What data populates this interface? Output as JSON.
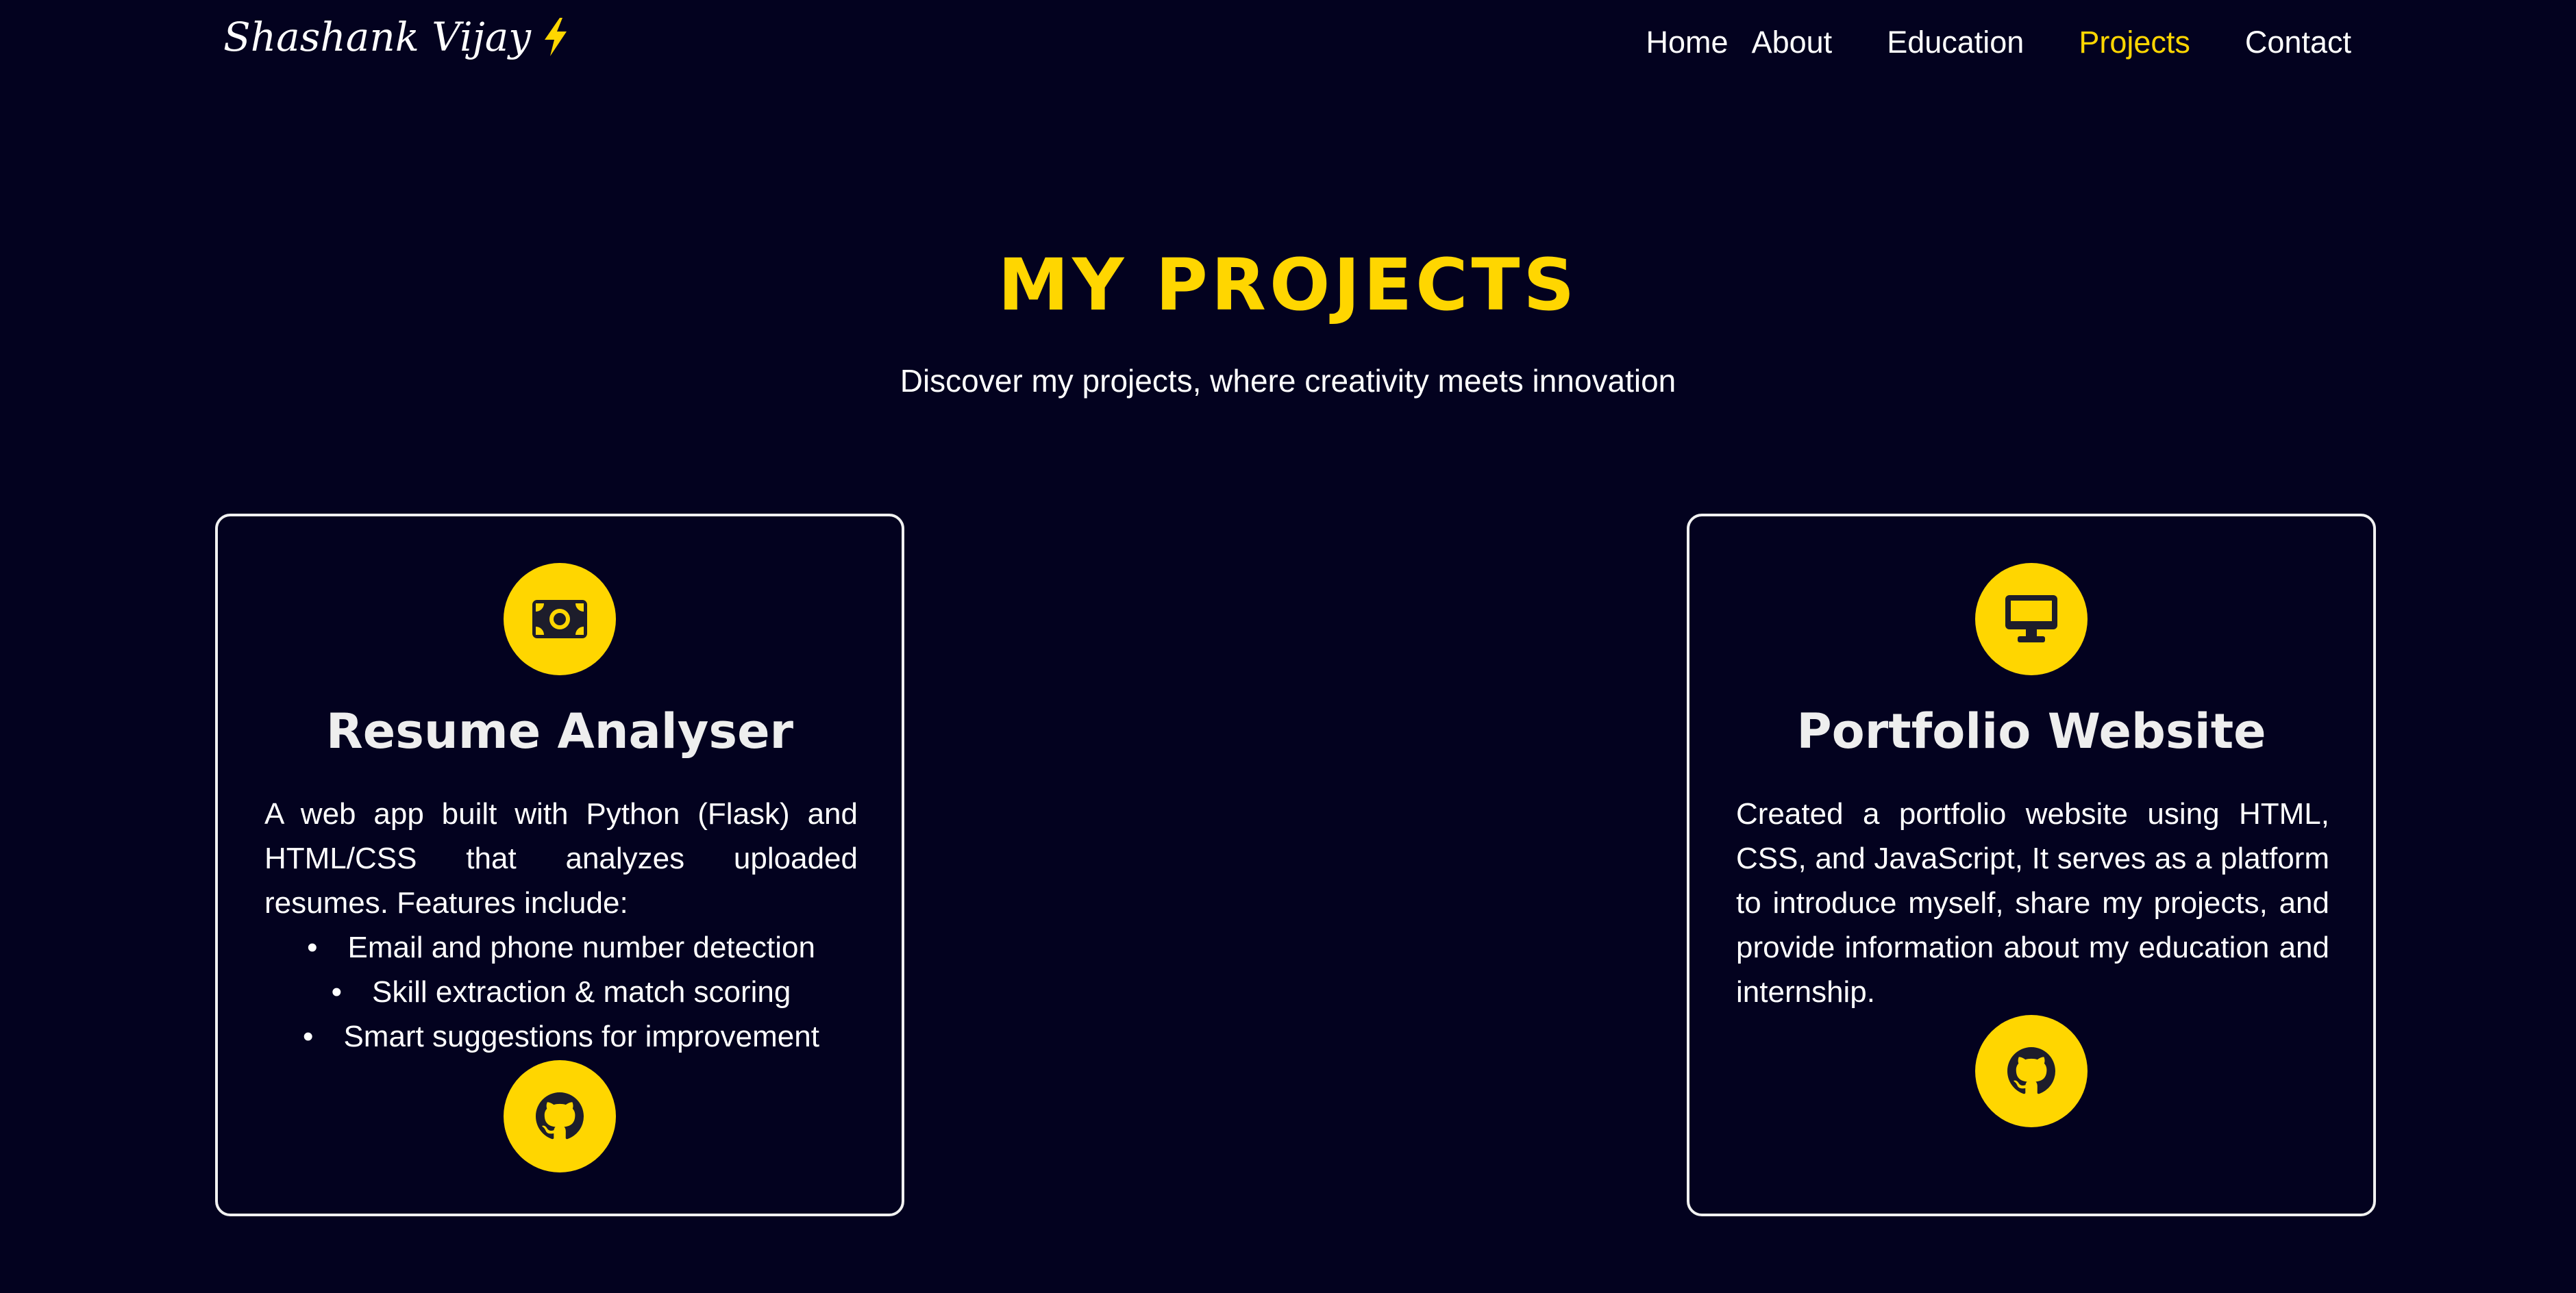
{
  "header": {
    "logo_text": "Shashank Vijay",
    "logo_icon": "lightning-bolt-icon",
    "nav": [
      {
        "label": "Home",
        "active": false
      },
      {
        "label": "About",
        "active": false
      },
      {
        "label": "Education",
        "active": false
      },
      {
        "label": "Projects",
        "active": true
      },
      {
        "label": "Contact",
        "active": false
      }
    ]
  },
  "section": {
    "title": "MY PROJECTS",
    "subtitle": "Discover my projects, where creativity meets innovation"
  },
  "projects": [
    {
      "icon": "money-bill-icon",
      "title": "Resume Analyser",
      "description": "A web app built with Python (Flask) and HTML/CSS that analyzes uploaded resumes. Features include:",
      "features": [
        "Email and phone number detection",
        "Skill extraction & match scoring",
        "Smart suggestions for improvement"
      ],
      "link_icon": "github-icon"
    },
    {
      "icon": "desktop-monitor-icon",
      "title": "Portfolio Website",
      "description": "Created a portfolio website using HTML, CSS, and JavaScript, It serves as a platform to introduce myself, share my projects, and provide information about my education and internship.",
      "link_icon": "github-icon"
    }
  ],
  "colors": {
    "background": "#03021f",
    "accent": "#ffd600",
    "text": "#ffffff",
    "card_border": "#f1f1f1"
  }
}
